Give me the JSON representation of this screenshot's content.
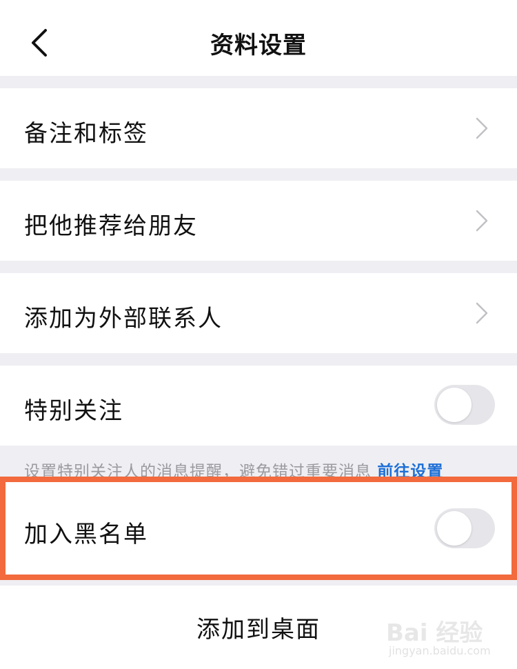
{
  "header": {
    "title": "资料设置"
  },
  "rows": {
    "remarks": "备注和标签",
    "recommend": "把他推荐给朋友",
    "external": "添加为外部联系人",
    "special": "特别关注",
    "blacklist": "加入黑名单",
    "desktop": "添加到桌面"
  },
  "hint": {
    "text": "设置特别关注人的消息提醒，避免错过重要消息",
    "link": "前往设置"
  },
  "toggles": {
    "special_on": false,
    "blacklist_on": false
  },
  "colors": {
    "highlight": "#f26a3d",
    "link": "#1d6fd6",
    "background": "#efeff3"
  },
  "watermark": {
    "line1": "Bai 经验",
    "line2": "jingyan.baidu.com"
  }
}
